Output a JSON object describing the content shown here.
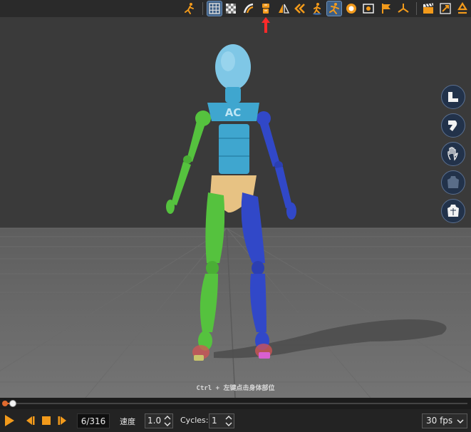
{
  "toolbar": {
    "icons": [
      "pose-figure-icon",
      "grid-icon",
      "checker-floor-icon",
      "lighting-icon",
      "body-front-icon",
      "mirror-icon",
      "undo-pose-icon",
      "walk-icon",
      "run-icon",
      "cycle-icon",
      "camera-frame-icon",
      "flag-icon",
      "axis-icon",
      "clapper-icon",
      "export-icon",
      "recycle-icon"
    ],
    "accent": "#f29a1b"
  },
  "viewport": {
    "hint": "Ctrl + 左键点击身体部位",
    "torso_label": "AC"
  },
  "side_panel": [
    "arm-pose-icon",
    "leg-pose-icon",
    "hand-icon",
    "body-back-icon",
    "body-front-view-icon"
  ],
  "timeline": {
    "current_frame": 6,
    "total_frames": 316,
    "progress": 0.019
  },
  "controls": {
    "frame_display": "6/316",
    "speed_label": "速度",
    "speed_value": "1.0",
    "cycles_label": "Cycles:",
    "cycles_value": "1",
    "fps_value": "30 fps"
  },
  "colors": {
    "accent": "#e06a2e",
    "head": "#7fc7e6",
    "torso": "#3fa6cf",
    "left_limb": "#55c23e",
    "right_limb": "#3148c8",
    "pelvis": "#e7c283"
  }
}
